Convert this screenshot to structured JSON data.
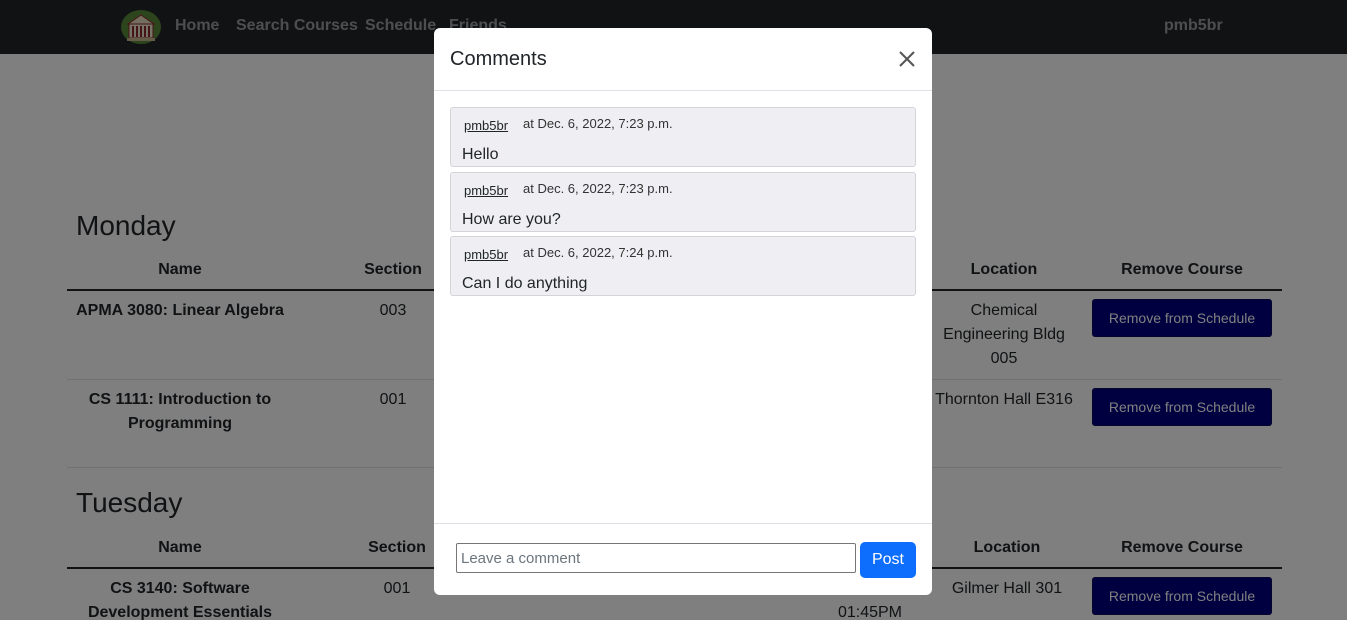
{
  "nav": {
    "links": [
      "Home",
      "Search Courses",
      "Schedule",
      "Friends"
    ],
    "user": "pmb5br"
  },
  "schedule": {
    "headers": {
      "name": "Name",
      "section": "Section",
      "location": "Location",
      "remove": "Remove Course"
    },
    "remove_label": "Remove from Schedule",
    "days": [
      {
        "title": "Monday",
        "rows": [
          {
            "name": "APMA 3080: Linear Algebra",
            "section": "003",
            "location": "Chemical Engineering Bldg 005"
          },
          {
            "name": "CS 1111: Introduction to Programming",
            "section": "001",
            "location": "Thornton Hall E316"
          }
        ]
      },
      {
        "title": "Tuesday",
        "rows": [
          {
            "name": "CS 3140: Software Development Essentials",
            "section": "001",
            "time_partial": "01:45PM",
            "location": "Gilmer Hall 301"
          }
        ]
      }
    ]
  },
  "modal": {
    "title": "Comments",
    "comments": [
      {
        "user": "pmb5br",
        "time": "at Dec. 6, 2022, 7:23 p.m.",
        "text": "Hello"
      },
      {
        "user": "pmb5br",
        "time": "at Dec. 6, 2022, 7:23 p.m.",
        "text": "How are you?"
      },
      {
        "user": "pmb5br",
        "time": "at Dec. 6, 2022, 7:24 p.m.",
        "text": "Can I do anything"
      }
    ],
    "input_placeholder": "Leave a comment",
    "post_label": "Post"
  }
}
